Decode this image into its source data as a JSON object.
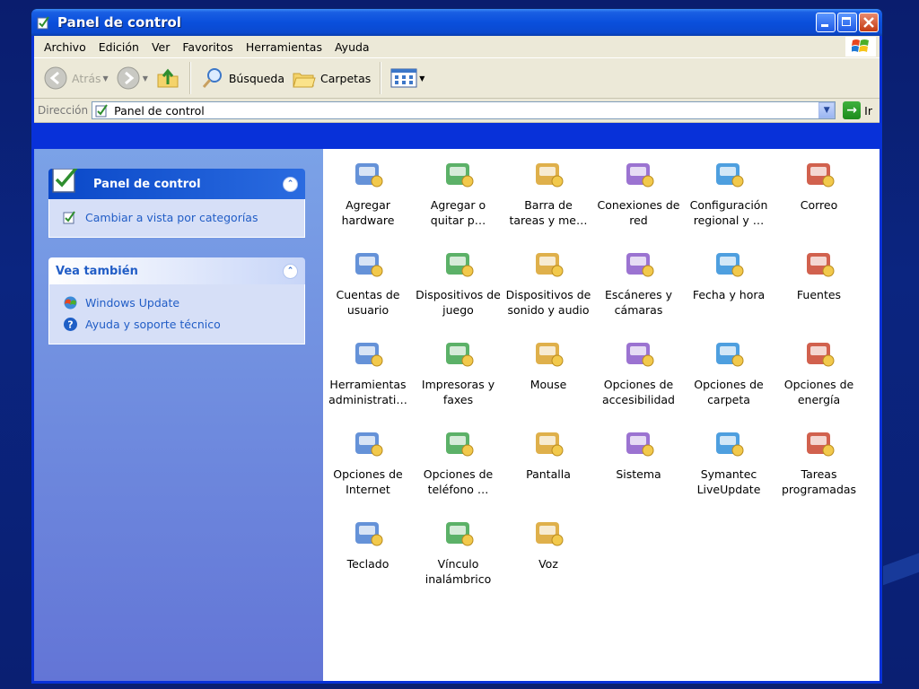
{
  "window": {
    "title": "Panel de control"
  },
  "menubar": {
    "items": [
      "Archivo",
      "Edición",
      "Ver",
      "Favoritos",
      "Herramientas",
      "Ayuda"
    ]
  },
  "toolbar": {
    "back": "Atrás",
    "search": "Búsqueda",
    "folders": "Carpetas"
  },
  "address": {
    "label": "Dirección",
    "value": "Panel de control",
    "go": "Ir"
  },
  "taskpane": {
    "panel1": {
      "title": "Panel de control",
      "link": "Cambiar a vista por categorías"
    },
    "panel2": {
      "title": "Vea también",
      "links": [
        "Windows Update",
        "Ayuda y soporte técnico"
      ]
    }
  },
  "items": [
    {
      "l1": "Agregar",
      "l2": "hardware",
      "icon": "add-hardware-icon"
    },
    {
      "l1": "Agregar o",
      "l2": "quitar p…",
      "icon": "add-remove-programs-icon"
    },
    {
      "l1": "Barra de",
      "l2": "tareas y me…",
      "icon": "taskbar-icon"
    },
    {
      "l1": "Conexiones de",
      "l2": "red",
      "icon": "network-connections-icon"
    },
    {
      "l1": "Configuración",
      "l2": "regional y …",
      "icon": "regional-settings-icon"
    },
    {
      "l1": "Correo",
      "l2": "",
      "icon": "mail-icon"
    },
    {
      "l1": "Cuentas de",
      "l2": "usuario",
      "icon": "user-accounts-icon"
    },
    {
      "l1": "Dispositivos de",
      "l2": "juego",
      "icon": "game-controllers-icon"
    },
    {
      "l1": "Dispositivos de",
      "l2": "sonido y audio",
      "icon": "sound-audio-icon"
    },
    {
      "l1": "Escáneres y",
      "l2": "cámaras",
      "icon": "scanners-cameras-icon"
    },
    {
      "l1": "Fecha y hora",
      "l2": "",
      "icon": "date-time-icon"
    },
    {
      "l1": "Fuentes",
      "l2": "",
      "icon": "fonts-folder-icon"
    },
    {
      "l1": "Herramientas",
      "l2": "administrati…",
      "icon": "admin-tools-icon"
    },
    {
      "l1": "Impresoras y",
      "l2": "faxes",
      "icon": "printers-faxes-icon"
    },
    {
      "l1": "Mouse",
      "l2": "",
      "icon": "mouse-icon"
    },
    {
      "l1": "Opciones de",
      "l2": "accesibilidad",
      "icon": "accessibility-icon"
    },
    {
      "l1": "Opciones de",
      "l2": "carpeta",
      "icon": "folder-options-icon"
    },
    {
      "l1": "Opciones de",
      "l2": "energía",
      "icon": "power-options-icon"
    },
    {
      "l1": "Opciones de",
      "l2": "Internet",
      "icon": "internet-options-icon"
    },
    {
      "l1": "Opciones de",
      "l2": "teléfono …",
      "icon": "phone-modem-icon"
    },
    {
      "l1": "Pantalla",
      "l2": "",
      "icon": "display-icon"
    },
    {
      "l1": "Sistema",
      "l2": "",
      "icon": "system-icon"
    },
    {
      "l1": "Symantec",
      "l2": "LiveUpdate",
      "icon": "symantec-liveupdate-icon"
    },
    {
      "l1": "Tareas",
      "l2": "programadas",
      "icon": "scheduled-tasks-icon"
    },
    {
      "l1": "Teclado",
      "l2": "",
      "icon": "keyboard-icon"
    },
    {
      "l1": "Vínculo",
      "l2": "inalámbrico",
      "icon": "wireless-link-icon"
    },
    {
      "l1": "Voz",
      "l2": "",
      "icon": "speech-icon"
    }
  ]
}
